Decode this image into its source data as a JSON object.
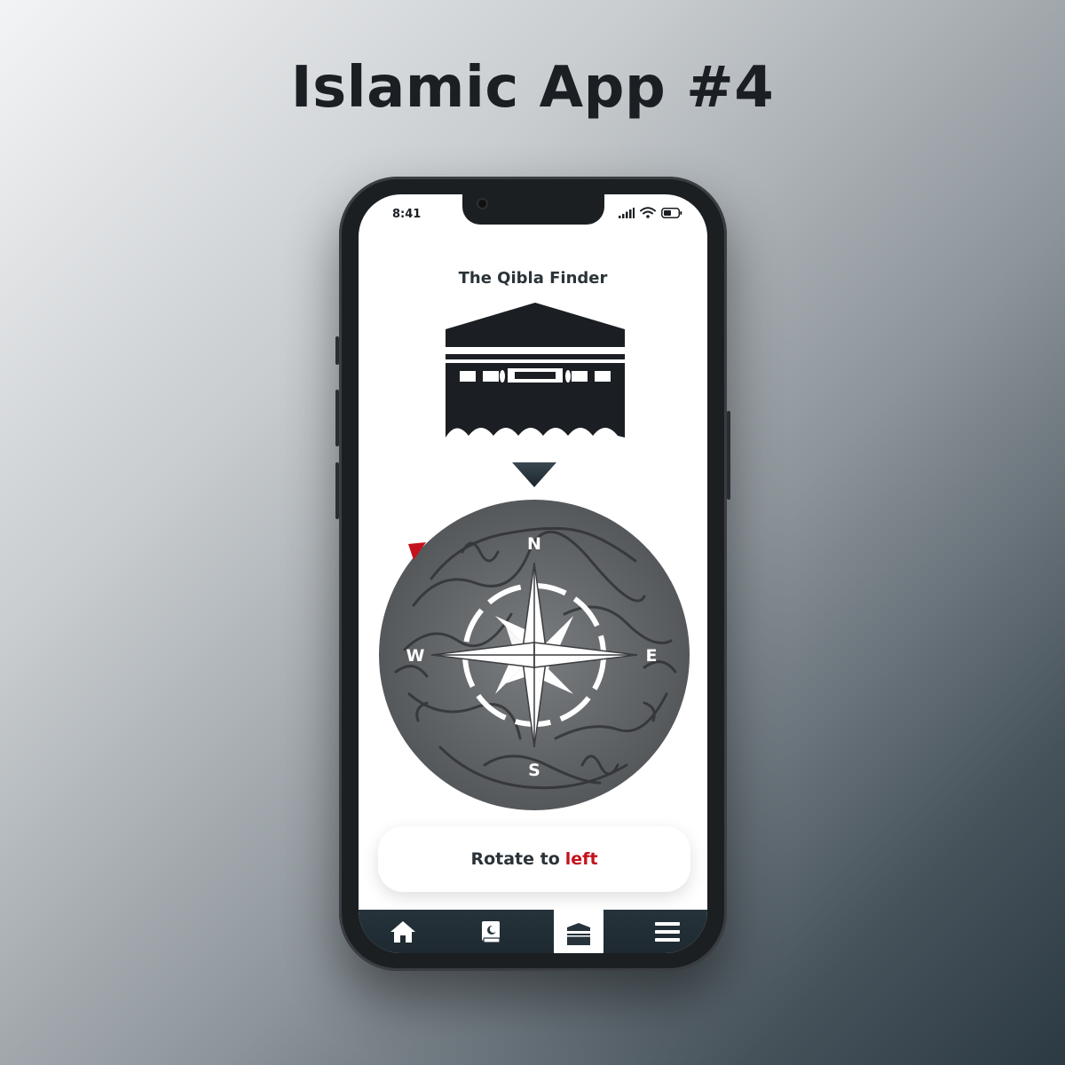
{
  "page": {
    "headline": "Islamic App #4"
  },
  "status_bar": {
    "time": "8:41"
  },
  "screen": {
    "title": "The Qibla Finder",
    "compass": {
      "north": "N",
      "south": "S",
      "east": "E",
      "west": "W"
    },
    "rotate_prefix": "Rotate to",
    "rotate_direction": "left"
  },
  "tabs": [
    {
      "icon": "home-icon"
    },
    {
      "icon": "quran-book-icon"
    },
    {
      "icon": "kaaba-icon",
      "active": true
    },
    {
      "icon": "menu-icon"
    }
  ],
  "colors": {
    "accent": "#c4121c",
    "dark": "#26333b",
    "compass": "#6a6d70"
  }
}
